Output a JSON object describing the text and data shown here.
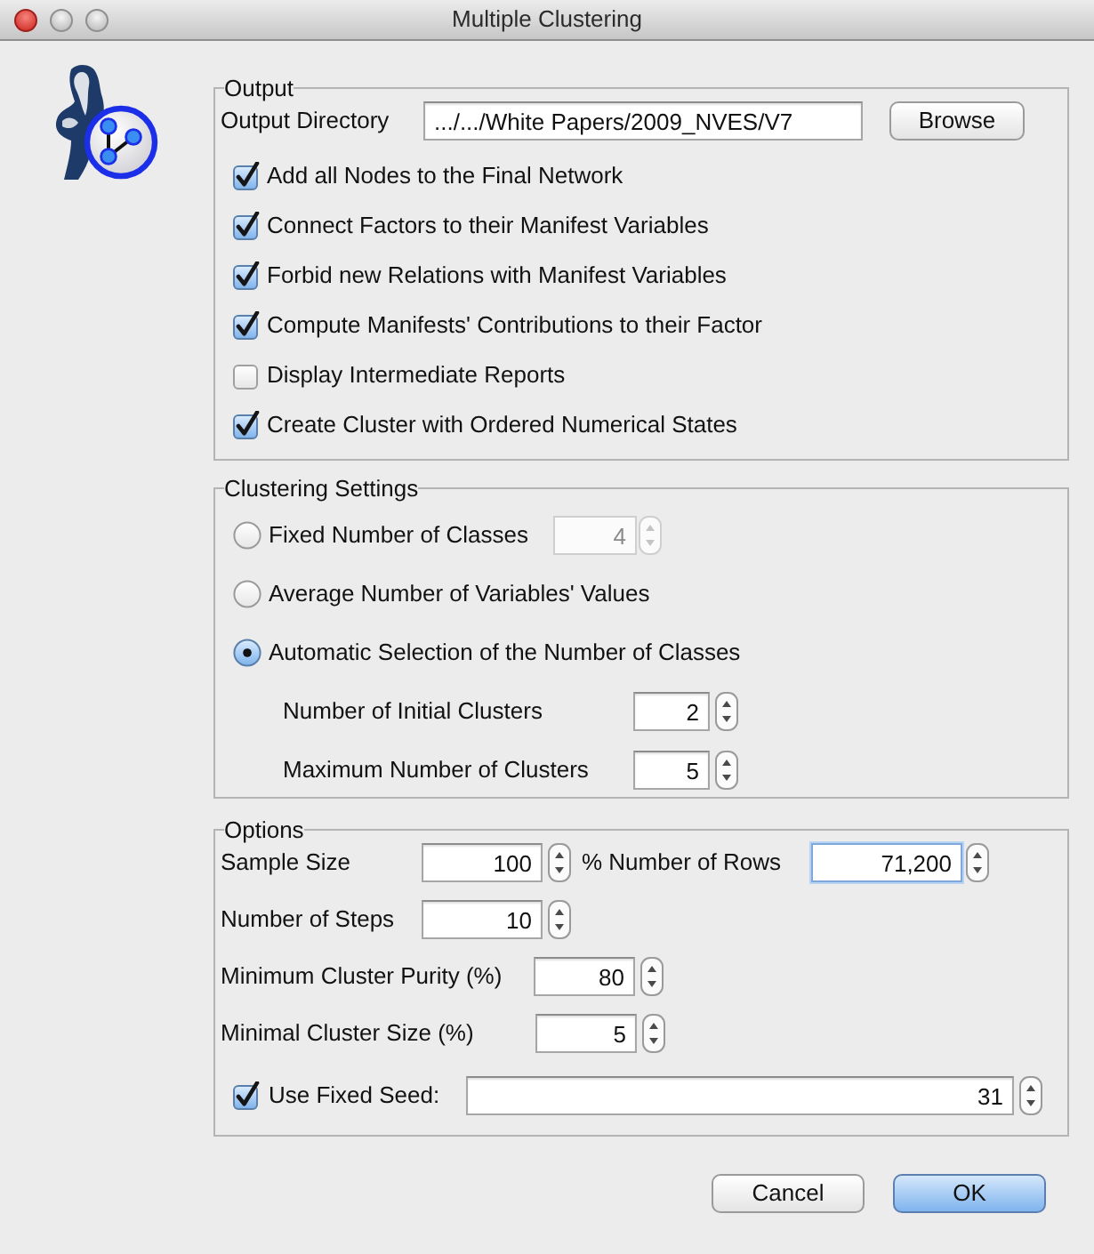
{
  "window": {
    "title": "Multiple Clustering"
  },
  "output": {
    "legend": "Output",
    "directory": {
      "label": "Output Directory",
      "value": ".../.../White Papers/2009_NVES/V7"
    },
    "browse_button": "Browse",
    "options": [
      {
        "label": "Add all Nodes to the Final Network",
        "checked": true
      },
      {
        "label": "Connect Factors to their Manifest Variables",
        "checked": true
      },
      {
        "label": "Forbid new Relations with Manifest Variables",
        "checked": true
      },
      {
        "label": "Compute Manifests' Contributions to their Factor",
        "checked": true
      },
      {
        "label": "Display Intermediate Reports",
        "checked": false
      },
      {
        "label": "Create Cluster with Ordered Numerical States",
        "checked": true
      }
    ]
  },
  "clustering_settings": {
    "legend": "Clustering Settings",
    "modes": [
      {
        "label": "Fixed Number of Classes",
        "selected": false,
        "spinner": {
          "value": "4",
          "disabled": true
        }
      },
      {
        "label": "Average Number of Variables' Values",
        "selected": false
      },
      {
        "label": "Automatic Selection of the Number of Classes",
        "selected": true,
        "fields": [
          {
            "label": "Number of Initial Clusters",
            "value": "2"
          },
          {
            "label": "Maximum Number of Clusters",
            "value": "5"
          }
        ]
      }
    ]
  },
  "options": {
    "legend": "Options",
    "sample_size": {
      "label": "Sample Size",
      "value": "100"
    },
    "number_of_rows": {
      "label": "% Number of Rows",
      "value": "71,200",
      "focused": true
    },
    "number_of_steps": {
      "label": "Number of Steps",
      "value": "10"
    },
    "minimum_cluster_purity": {
      "label": "Minimum Cluster Purity (%)",
      "value": "80"
    },
    "minimal_cluster_size": {
      "label": "Minimal Cluster Size (%)",
      "value": "5"
    },
    "fixed_seed": {
      "label": "Use Fixed Seed:",
      "checked": true,
      "value": "31"
    }
  },
  "buttons": [
    {
      "label": "Cancel",
      "default": false
    },
    {
      "label": "OK",
      "default": true
    }
  ]
}
